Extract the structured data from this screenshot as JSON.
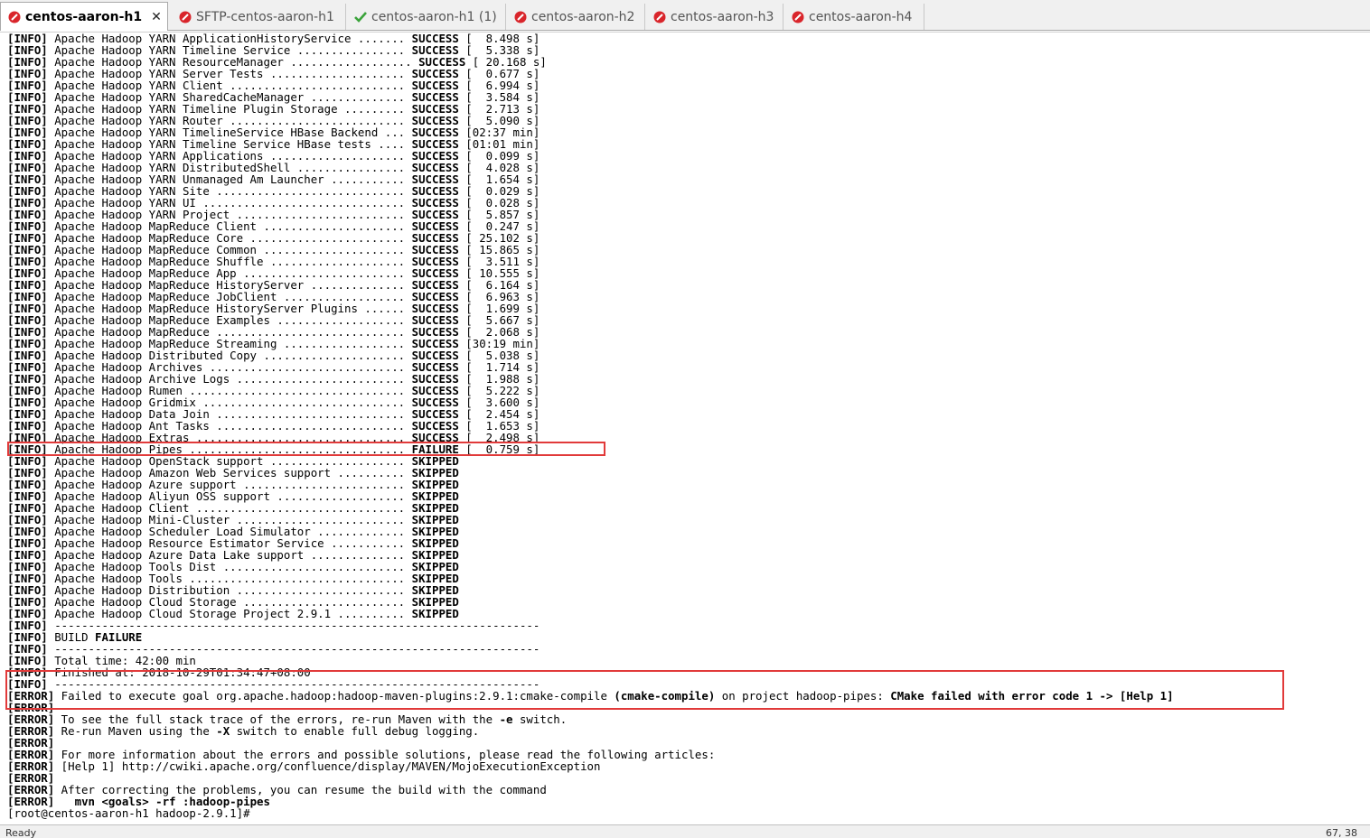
{
  "tabs": [
    {
      "label": "centos-aaron-h1",
      "active": true,
      "icon": "red-session-icon",
      "closable": true
    },
    {
      "label": "SFTP-centos-aaron-h1",
      "active": false,
      "icon": "red-session-icon"
    },
    {
      "label": "centos-aaron-h1 (1)",
      "active": false,
      "icon": "green-check-icon"
    },
    {
      "label": "centos-aaron-h2",
      "active": false,
      "icon": "red-session-icon"
    },
    {
      "label": "centos-aaron-h3",
      "active": false,
      "icon": "red-session-icon"
    },
    {
      "label": "centos-aaron-h4",
      "active": false,
      "icon": "red-session-icon"
    }
  ],
  "tab_close_glyph": "✕",
  "colors": {
    "highlight_border": "#e13a3a",
    "session_icon_red": "#d9252b",
    "check_green": "#3aa33a"
  },
  "terminal_lines": [
    {
      "text": "[INFO] Apache Hadoop YARN ApplicationHistoryService ....... SUCCESS [  8.498 s]"
    },
    {
      "text": "[INFO] Apache Hadoop YARN Timeline Service ................ SUCCESS [  5.338 s]"
    },
    {
      "text": "[INFO] Apache Hadoop YARN ResourceManager .................. SUCCESS [ 20.168 s]"
    },
    {
      "text": "[INFO] Apache Hadoop YARN Server Tests .................... SUCCESS [  0.677 s]"
    },
    {
      "text": "[INFO] Apache Hadoop YARN Client .......................... SUCCESS [  6.994 s]"
    },
    {
      "text": "[INFO] Apache Hadoop YARN SharedCacheManager .............. SUCCESS [  3.584 s]"
    },
    {
      "text": "[INFO] Apache Hadoop YARN Timeline Plugin Storage ......... SUCCESS [  2.713 s]"
    },
    {
      "text": "[INFO] Apache Hadoop YARN Router .......................... SUCCESS [  5.090 s]"
    },
    {
      "text": "[INFO] Apache Hadoop YARN TimelineService HBase Backend ... SUCCESS [02:37 min]"
    },
    {
      "text": "[INFO] Apache Hadoop YARN Timeline Service HBase tests .... SUCCESS [01:01 min]"
    },
    {
      "text": "[INFO] Apache Hadoop YARN Applications .................... SUCCESS [  0.099 s]"
    },
    {
      "text": "[INFO] Apache Hadoop YARN DistributedShell ................ SUCCESS [  4.028 s]"
    },
    {
      "text": "[INFO] Apache Hadoop YARN Unmanaged Am Launcher ........... SUCCESS [  1.654 s]"
    },
    {
      "text": "[INFO] Apache Hadoop YARN Site ............................ SUCCESS [  0.029 s]"
    },
    {
      "text": "[INFO] Apache Hadoop YARN UI .............................. SUCCESS [  0.028 s]"
    },
    {
      "text": "[INFO] Apache Hadoop YARN Project ......................... SUCCESS [  5.857 s]"
    },
    {
      "text": "[INFO] Apache Hadoop MapReduce Client ..................... SUCCESS [  0.247 s]"
    },
    {
      "text": "[INFO] Apache Hadoop MapReduce Core ....................... SUCCESS [ 25.102 s]"
    },
    {
      "text": "[INFO] Apache Hadoop MapReduce Common ..................... SUCCESS [ 15.865 s]"
    },
    {
      "text": "[INFO] Apache Hadoop MapReduce Shuffle .................... SUCCESS [  3.511 s]"
    },
    {
      "text": "[INFO] Apache Hadoop MapReduce App ........................ SUCCESS [ 10.555 s]"
    },
    {
      "text": "[INFO] Apache Hadoop MapReduce HistoryServer .............. SUCCESS [  6.164 s]"
    },
    {
      "text": "[INFO] Apache Hadoop MapReduce JobClient .................. SUCCESS [  6.963 s]"
    },
    {
      "text": "[INFO] Apache Hadoop MapReduce HistoryServer Plugins ...... SUCCESS [  1.699 s]"
    },
    {
      "text": "[INFO] Apache Hadoop MapReduce Examples ................... SUCCESS [  5.667 s]"
    },
    {
      "text": "[INFO] Apache Hadoop MapReduce ............................ SUCCESS [  2.068 s]"
    },
    {
      "text": "[INFO] Apache Hadoop MapReduce Streaming .................. SUCCESS [30:19 min]"
    },
    {
      "text": "[INFO] Apache Hadoop Distributed Copy ..................... SUCCESS [  5.038 s]"
    },
    {
      "text": "[INFO] Apache Hadoop Archives ............................. SUCCESS [  1.714 s]"
    },
    {
      "text": "[INFO] Apache Hadoop Archive Logs ......................... SUCCESS [  1.988 s]"
    },
    {
      "text": "[INFO] Apache Hadoop Rumen ................................ SUCCESS [  5.222 s]"
    },
    {
      "text": "[INFO] Apache Hadoop Gridmix .............................. SUCCESS [  3.600 s]"
    },
    {
      "text": "[INFO] Apache Hadoop Data Join ............................ SUCCESS [  2.454 s]"
    },
    {
      "text": "[INFO] Apache Hadoop Ant Tasks ............................ SUCCESS [  1.653 s]"
    },
    {
      "text": "[INFO] Apache Hadoop Extras ............................... SUCCESS [  2.498 s]"
    },
    {
      "text": "[INFO] Apache Hadoop Pipes ................................ FAILURE [  0.759 s]"
    },
    {
      "text": "[INFO] Apache Hadoop OpenStack support .................... SKIPPED"
    },
    {
      "text": "[INFO] Apache Hadoop Amazon Web Services support .......... SKIPPED"
    },
    {
      "text": "[INFO] Apache Hadoop Azure support ........................ SKIPPED"
    },
    {
      "text": "[INFO] Apache Hadoop Aliyun OSS support ................... SKIPPED"
    },
    {
      "text": "[INFO] Apache Hadoop Client ............................... SKIPPED"
    },
    {
      "text": "[INFO] Apache Hadoop Mini-Cluster ......................... SKIPPED"
    },
    {
      "text": "[INFO] Apache Hadoop Scheduler Load Simulator ............. SKIPPED"
    },
    {
      "text": "[INFO] Apache Hadoop Resource Estimator Service ........... SKIPPED"
    },
    {
      "text": "[INFO] Apache Hadoop Azure Data Lake support .............. SKIPPED"
    },
    {
      "text": "[INFO] Apache Hadoop Tools Dist ........................... SKIPPED"
    },
    {
      "text": "[INFO] Apache Hadoop Tools ................................ SKIPPED"
    },
    {
      "text": "[INFO] Apache Hadoop Distribution ......................... SKIPPED"
    },
    {
      "text": "[INFO] Apache Hadoop Cloud Storage ........................ SKIPPED"
    },
    {
      "text": "[INFO] Apache Hadoop Cloud Storage Project 2.9.1 .......... SKIPPED"
    },
    {
      "text": "[INFO] ------------------------------------------------------------------------"
    },
    {
      "text": "[INFO] BUILD FAILURE"
    },
    {
      "text": "[INFO] ------------------------------------------------------------------------"
    },
    {
      "text": "[INFO] Total time: 42:00 min"
    },
    {
      "text": "[INFO] Finished at: 2018-10-29T01:34:47+08:00"
    },
    {
      "text": "[INFO] ------------------------------------------------------------------------"
    },
    {
      "text": "[ERROR] Failed to execute goal org.apache.hadoop:hadoop-maven-plugins:2.9.1:cmake-compile (cmake-compile) on project hadoop-pipes: CMake failed with error code 1 -> [Help 1]"
    },
    {
      "text": "[ERROR]"
    },
    {
      "text": "[ERROR] To see the full stack trace of the errors, re-run Maven with the -e switch."
    },
    {
      "text": "[ERROR] Re-run Maven using the -X switch to enable full debug logging."
    },
    {
      "text": "[ERROR]"
    },
    {
      "text": "[ERROR] For more information about the errors and possible solutions, please read the following articles:"
    },
    {
      "text": "[ERROR] [Help 1] http://cwiki.apache.org/confluence/display/MAVEN/MojoExecutionException"
    },
    {
      "text": "[ERROR]"
    },
    {
      "text": "[ERROR] After correcting the problems, you can resume the build with the command"
    },
    {
      "text": "[ERROR]   mvn <goals> -rf :hadoop-pipes"
    },
    {
      "text": "[root@centos-aaron-h1 hadoop-2.9.1]#"
    }
  ],
  "status_bar": {
    "left": "Ready",
    "right": "67, 38"
  }
}
